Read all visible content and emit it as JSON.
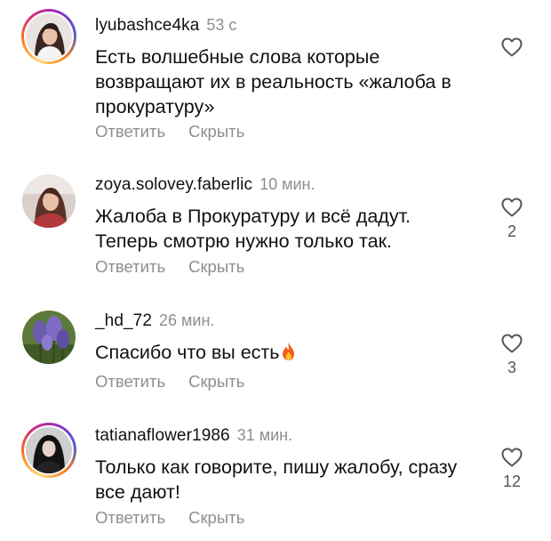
{
  "comments": [
    {
      "username": "lyubashce4ka",
      "time": "53 с",
      "text": "Есть волшебные слова которые возвращают их в реальность «жалоба в прокуратуру»",
      "reply_label": "Ответить",
      "hide_label": "Скрыть",
      "likes": "",
      "has_story_ring": true
    },
    {
      "username": "zoya.solovey.faberlic",
      "time": "10 мин.",
      "text": "Жалоба в Прокуратуру и всё дадут. Теперь смотрю нужно только так.",
      "reply_label": "Ответить",
      "hide_label": "Скрыть",
      "likes": "2",
      "has_story_ring": false
    },
    {
      "username": "_hd_72",
      "time": "26 мин.",
      "text": "Спасибо что вы есть",
      "text_emoji": "fire-emoji",
      "reply_label": "Ответить",
      "hide_label": "Скрыть",
      "likes": "3",
      "has_story_ring": false
    },
    {
      "username": "tatianaflower1986",
      "time": "31 мин.",
      "text": "Только как говорите, пишу жалобу, сразу все дают!",
      "reply_label": "Ответить",
      "hide_label": "Скрыть",
      "likes": "12",
      "has_story_ring": true
    }
  ],
  "icons": {
    "like": "heart-outline-icon"
  },
  "colors": {
    "text": "#111111",
    "secondary": "#8e8e8e"
  }
}
